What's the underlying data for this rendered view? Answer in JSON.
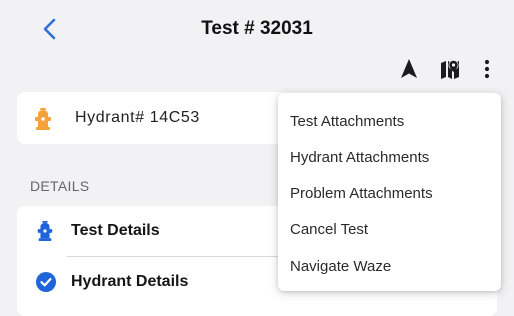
{
  "header": {
    "title": "Test # 32031",
    "back_icon": "chevron-left-icon",
    "actions": [
      "navigation-arrow-icon",
      "map-pin-icon",
      "more-vertical-icon"
    ]
  },
  "hydrant": {
    "label": "Hydrant# 14C53",
    "icon": "fire-hydrant-icon"
  },
  "details": {
    "section_label": "DETAILS",
    "items": [
      {
        "label": "Test Details",
        "icon": "fire-hydrant-icon"
      },
      {
        "label": "Hydrant Details",
        "icon": "check-circle-icon"
      }
    ]
  },
  "menu": {
    "items": [
      {
        "label": "Test Attachments"
      },
      {
        "label": "Hydrant Attachments"
      },
      {
        "label": "Problem Attachments"
      },
      {
        "label": "Cancel Test"
      },
      {
        "label": "Navigate Waze"
      }
    ]
  },
  "colors": {
    "accent": "#2d6fd6",
    "hydrant_orange": "#f5a23a",
    "hydrant_blue": "#1f64d8",
    "background": "#f2f2f4"
  }
}
